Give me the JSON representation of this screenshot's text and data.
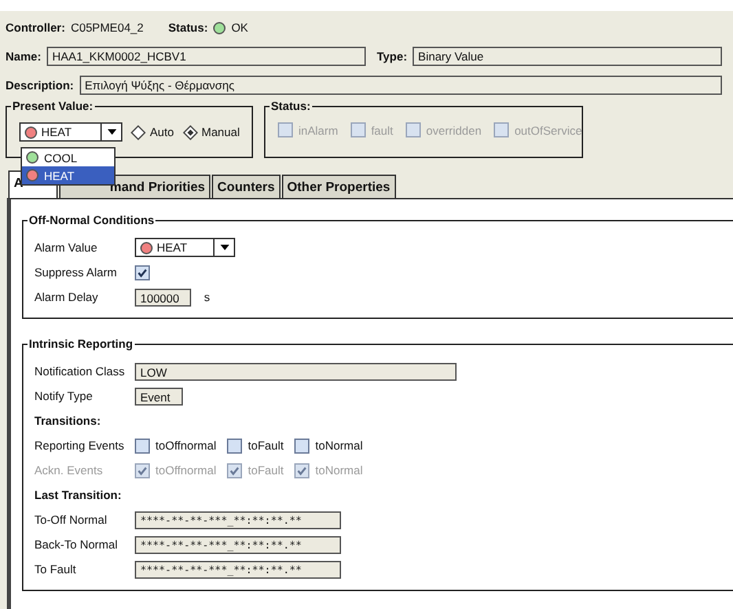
{
  "header": {
    "controller": {
      "label": "Controller:",
      "value": "C05PME04_2"
    },
    "status": {
      "label": "Status:",
      "value": "OK",
      "color": "#9fe09a"
    },
    "name": {
      "label": "Name:",
      "value": "HAA1_KKM0002_HCBV1"
    },
    "type": {
      "label": "Type:",
      "value": "Binary Value"
    },
    "description": {
      "label": "Description:",
      "value": "Επιλογή Ψύξης - Θέρμανσης"
    }
  },
  "present_value": {
    "legend": "Present Value:",
    "dropdown": {
      "value": "HEAT",
      "color": "#f08080",
      "expanded": true,
      "options": [
        {
          "label": "COOL",
          "color": "#9fe09a",
          "selected": false
        },
        {
          "label": "HEAT",
          "color": "#f08080",
          "selected": true
        }
      ]
    },
    "modes": [
      {
        "label": "Auto",
        "selected": false
      },
      {
        "label": "Manual",
        "selected": true
      }
    ]
  },
  "status_flags": {
    "legend": "Status:",
    "flags": [
      {
        "label": "inAlarm",
        "checked": false,
        "disabled": true
      },
      {
        "label": "fault",
        "checked": false,
        "disabled": true
      },
      {
        "label": "overridden",
        "checked": false,
        "disabled": true
      },
      {
        "label": "outOfService",
        "checked": false,
        "disabled": true
      }
    ]
  },
  "tabs": [
    {
      "label": "A",
      "selected": true
    },
    {
      "label": "mand Priorities",
      "selected": false
    },
    {
      "label": "Counters",
      "selected": false
    },
    {
      "label": "Other Properties",
      "selected": false
    }
  ],
  "sections": [
    {
      "legend": "Off-Normal Conditions",
      "rows": [
        {
          "kind": "dropdown",
          "label": "Alarm Value",
          "value": "HEAT",
          "color": "#f08080"
        },
        {
          "kind": "checkbox",
          "label": "Suppress Alarm",
          "checked": true,
          "disabled": false
        },
        {
          "kind": "field",
          "label": "Alarm Delay",
          "value": "100000",
          "unit": "s"
        }
      ]
    },
    {
      "legend": "Intrinsic Reporting",
      "rows": [
        {
          "kind": "wide_field",
          "label": "Notification Class",
          "value": "LOW"
        },
        {
          "kind": "field",
          "label": "Notify Type",
          "value": "Event"
        },
        {
          "kind": "heading",
          "label": "Transitions:"
        },
        {
          "kind": "checks",
          "label": "Reporting Events",
          "disabled": false,
          "items": [
            {
              "label": "toOffnormal",
              "checked": false
            },
            {
              "label": "toFault",
              "checked": false
            },
            {
              "label": "toNormal",
              "checked": false
            }
          ]
        },
        {
          "kind": "checks",
          "label": "Ackn. Events",
          "disabled": true,
          "items": [
            {
              "label": "toOffnormal",
              "checked": true
            },
            {
              "label": "toFault",
              "checked": true
            },
            {
              "label": "toNormal",
              "checked": true
            }
          ]
        },
        {
          "kind": "heading",
          "label": "Last Transition:"
        },
        {
          "kind": "timestamp",
          "label": "To-Off Normal",
          "value": "****-**-**-***_**:**:**.**"
        },
        {
          "kind": "timestamp",
          "label": "Back-To Normal",
          "value": "****-**-**-***_**:**:**.**"
        },
        {
          "kind": "timestamp",
          "label": "To Fault",
          "value": "****-**-**-***_**:**:**.**"
        }
      ]
    }
  ]
}
